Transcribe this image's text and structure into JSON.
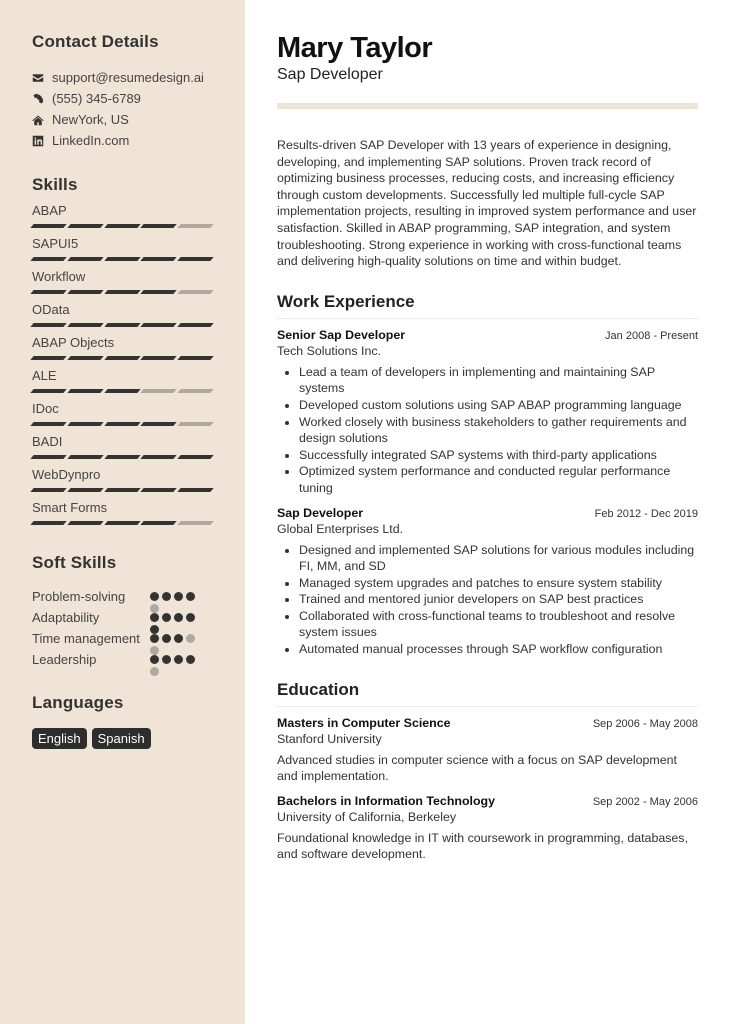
{
  "sidebar": {
    "contact": {
      "heading": "Contact Details",
      "items": [
        {
          "icon": "envelope-icon",
          "text": "support@resumedesign.ai"
        },
        {
          "icon": "phone-icon",
          "text": "(555) 345-6789"
        },
        {
          "icon": "home-icon",
          "text": "NewYork, US"
        },
        {
          "icon": "linkedin-icon",
          "text": "LinkedIn.com"
        }
      ]
    },
    "skills": {
      "heading": "Skills",
      "items": [
        {
          "name": "ABAP",
          "level": 4,
          "max": 5
        },
        {
          "name": "SAPUI5",
          "level": 5,
          "max": 5
        },
        {
          "name": "Workflow",
          "level": 4,
          "max": 5
        },
        {
          "name": "OData",
          "level": 5,
          "max": 5
        },
        {
          "name": "ABAP Objects",
          "level": 5,
          "max": 5
        },
        {
          "name": "ALE",
          "level": 3,
          "max": 5
        },
        {
          "name": "IDoc",
          "level": 4,
          "max": 5
        },
        {
          "name": "BADI",
          "level": 5,
          "max": 5
        },
        {
          "name": "WebDynpro",
          "level": 5,
          "max": 5
        },
        {
          "name": "Smart Forms",
          "level": 4,
          "max": 5
        }
      ]
    },
    "soft_skills": {
      "heading": "Soft Skills",
      "items": [
        {
          "name": "Problem-solving",
          "level": 4,
          "max": 5
        },
        {
          "name": "Adaptability",
          "level": 5,
          "max": 5
        },
        {
          "name": "Time management",
          "level": 3,
          "max": 5
        },
        {
          "name": "Leadership",
          "level": 4,
          "max": 5
        }
      ]
    },
    "languages": {
      "heading": "Languages",
      "items": [
        "English",
        "Spanish"
      ]
    }
  },
  "main": {
    "name": "Mary Taylor",
    "title": "Sap Developer",
    "summary": "Results-driven SAP Developer with 13 years of experience in designing, developing, and implementing SAP solutions. Proven track record of optimizing business processes, reducing costs, and increasing efficiency through custom developments. Successfully led multiple full-cycle SAP implementation projects, resulting in improved system performance and user satisfaction. Skilled in ABAP programming, SAP integration, and system troubleshooting. Strong experience in working with cross-functional teams and delivering high-quality solutions on time and within budget.",
    "work": {
      "heading": "Work Experience",
      "jobs": [
        {
          "title": "Senior Sap Developer",
          "dates": "Jan 2008 - Present",
          "company": "Tech Solutions Inc.",
          "bullets": [
            "Lead a team of developers in implementing and maintaining SAP systems",
            "Developed custom solutions using SAP ABAP programming language",
            "Worked closely with business stakeholders to gather requirements and design solutions",
            "Successfully integrated SAP systems with third-party applications",
            "Optimized system performance and conducted regular performance tuning"
          ]
        },
        {
          "title": "Sap Developer",
          "dates": "Feb 2012 - Dec 2019",
          "company": "Global Enterprises Ltd.",
          "bullets": [
            "Designed and implemented SAP solutions for various modules including FI, MM, and SD",
            "Managed system upgrades and patches to ensure system stability",
            "Trained and mentored junior developers on SAP best practices",
            "Collaborated with cross-functional teams to troubleshoot and resolve system issues",
            "Automated manual processes through SAP workflow configuration"
          ]
        }
      ]
    },
    "education": {
      "heading": "Education",
      "items": [
        {
          "degree": "Masters in Computer Science",
          "dates": "Sep 2006 - May 2008",
          "school": "Stanford University",
          "description": "Advanced studies in computer science with a focus on SAP development and implementation."
        },
        {
          "degree": "Bachelors in Information Technology",
          "dates": "Sep 2002 - May 2006",
          "school": "University of California, Berkeley",
          "description": "Foundational knowledge in IT with coursework in programming, databases, and software development."
        }
      ]
    }
  }
}
